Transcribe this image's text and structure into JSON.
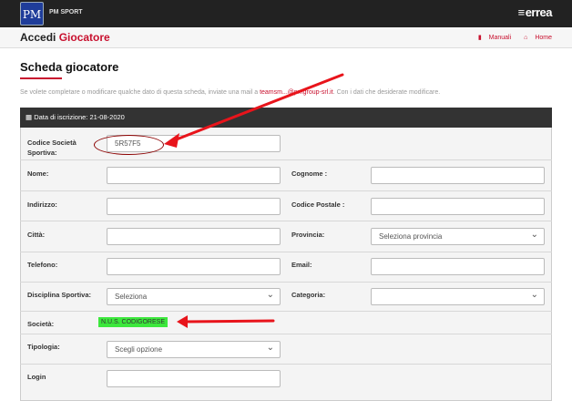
{
  "header": {
    "brand": "PM SPORT",
    "logo_text": "PM",
    "right_logo": "errea"
  },
  "subheader": {
    "title_prefix": "Accedi",
    "title_suffix": "Giocatore",
    "link_manuali": "Manuali",
    "link_home": "Home"
  },
  "page": {
    "title": "Scheda giocatore",
    "info_prefix": "Se volete completare o modificare qualche dato di questa scheda, inviate una mail a",
    "info_email": "teamsm...@pmgroup-srl.it",
    "info_suffix": ". Con i dati che desiderate modificare."
  },
  "panel": {
    "heading": "Data di iscrizione: 21-08-2020"
  },
  "form": {
    "codice_label": "Codice Società Sportiva:",
    "codice_value": "5R57F5",
    "nome_label": "Nome:",
    "cognome_label": "Cognome :",
    "indirizzo_label": "Indirizzo:",
    "cap_label": "Codice Postale :",
    "citta_label": "Città:",
    "provincia_label": "Provincia:",
    "provincia_value": "Seleziona provincia",
    "telefono_label": "Telefono:",
    "email_label": "Email:",
    "disciplina_label": "Disciplina Sportiva:",
    "disciplina_value": "Seleziona",
    "categoria_label": "Categoria:",
    "societa_label": "Società:",
    "societa_value": "N.U.S. CODIGORESE",
    "tipologia_label": "Tipologia:",
    "tipologia_value": "Scegli opzione",
    "login_label": "Login"
  },
  "colors": {
    "accent": "#c8102e",
    "header_bg": "#222222",
    "annotation": "#e8141b",
    "highlight": "#3ce83c"
  }
}
